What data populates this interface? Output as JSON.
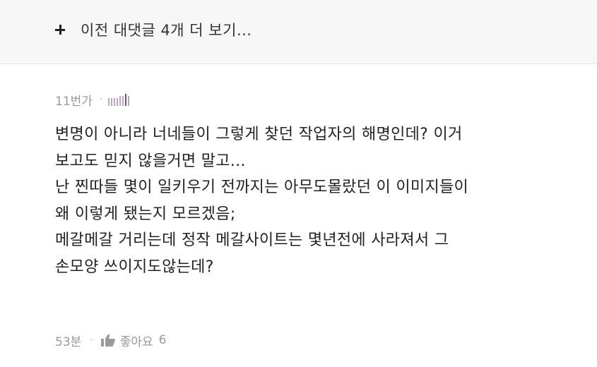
{
  "more_replies": {
    "label": "이전 대댓글 4개 더 보기..."
  },
  "comment": {
    "author": "11번가",
    "separator": "·",
    "badge_icon": "level-badge-icon",
    "body": "변명이 아니라 너네들이 그렇게 찾던 작업자의 해명인데? 이거\n보고도 믿지 않을거면 말고...\n난 찐따들 몇이 일키우기 전까지는 아무도몰랐던 이 이미지들이\n왜 이렇게 됐는지 모르겠음;\n메갈메갈 거리는데 정작 메갈사이트는 몇년전에 사라져서 그\n손모양 쓰이지도않는데?",
    "time": "53분",
    "like_label": "좋아요",
    "like_count": "6"
  },
  "colors": {
    "background": "#ffffff",
    "more_bar": "#f7f7f7",
    "meta_text": "#999999",
    "badge": "#b8a6d0"
  }
}
